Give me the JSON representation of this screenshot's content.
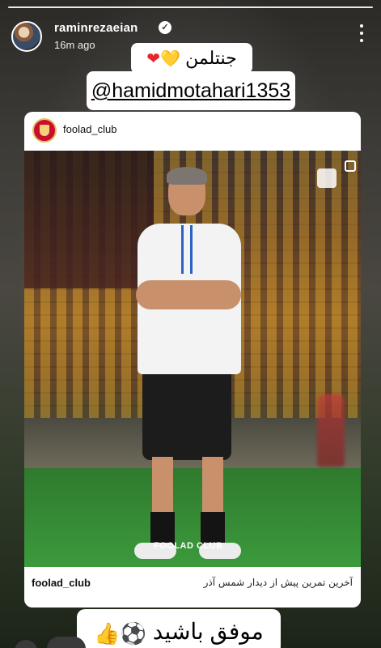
{
  "header": {
    "username": "raminrezaeian",
    "verified_glyph": "✓",
    "time_ago": "16m ago",
    "more_icon": "more-vertical-icon"
  },
  "stickers": {
    "line1_text": "جنتلمن",
    "line1_hearts": [
      "❤",
      "💛"
    ],
    "mention": "@hamidmotahari1353",
    "bottom_text": "موفق باشید",
    "bottom_emojis": [
      "⚽",
      "👍"
    ]
  },
  "shared_post": {
    "header_username": "foolad_club",
    "footer_username": "foolad_club",
    "caption": "آخرین تمرین پیش از دیدار شمس آذر",
    "photo_watermark": "FOOLAD CLUB"
  },
  "colors": {
    "heart_red": "#e8252c",
    "heart_yellow": "#f2c014",
    "club_red": "#c8102e"
  }
}
